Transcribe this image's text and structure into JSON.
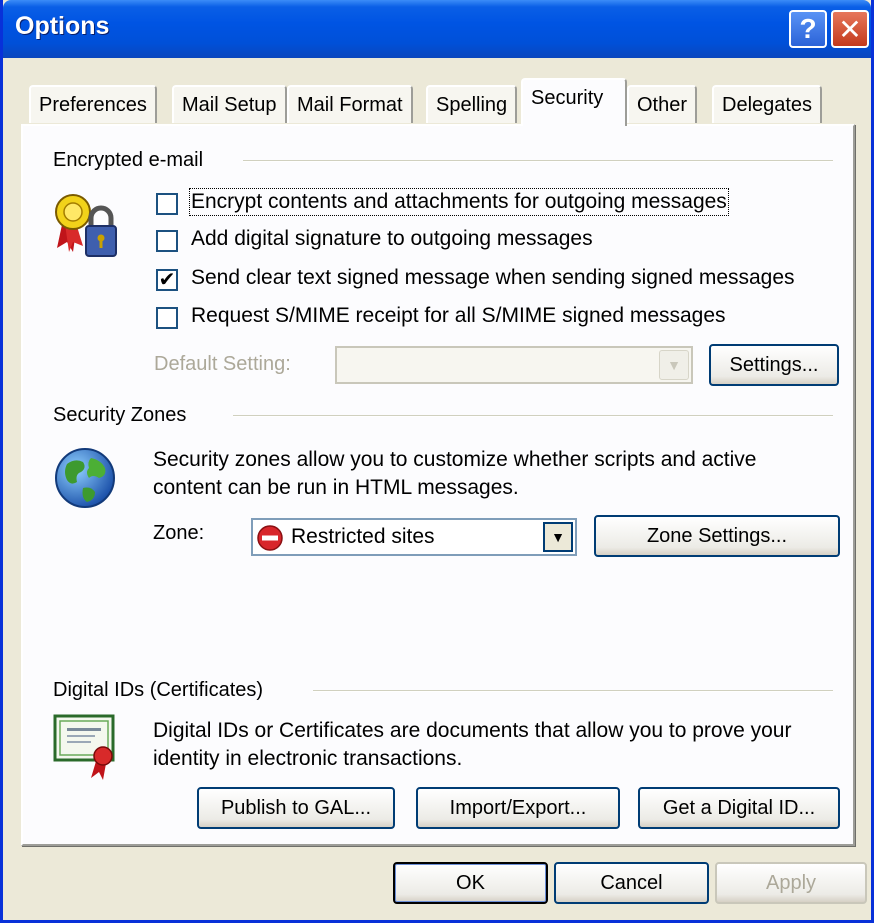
{
  "window": {
    "title": "Options"
  },
  "titlebar": {
    "help_glyph": "?",
    "close_glyph": "✕"
  },
  "tabs": [
    {
      "label": "Preferences"
    },
    {
      "label": "Mail Setup"
    },
    {
      "label": "Mail Format"
    },
    {
      "label": "Spelling"
    },
    {
      "label": "Security",
      "active": true
    },
    {
      "label": "Other"
    },
    {
      "label": "Delegates"
    }
  ],
  "encrypted": {
    "heading": "Encrypted e-mail",
    "icon": "certificate-lock-icon",
    "options": [
      {
        "label": "Encrypt contents and attachments for outgoing messages",
        "checked": false
      },
      {
        "label": "Add digital signature to outgoing messages",
        "checked": false
      },
      {
        "label": "Send clear text signed message when sending signed messages",
        "checked": true
      },
      {
        "label": "Request S/MIME receipt for all S/MIME signed messages",
        "checked": false
      }
    ],
    "default_setting_label": "Default Setting:",
    "default_setting_value": "",
    "settings_button": "Settings..."
  },
  "zones": {
    "heading": "Security Zones",
    "icon": "globe-icon",
    "description_line1": "Security zones allow you to customize whether scripts and active",
    "description_line2": "content can be run in HTML messages.",
    "zone_label": "Zone:",
    "zone_value": "Restricted sites",
    "zone_icon": "restricted-icon",
    "zone_settings_button": "Zone Settings..."
  },
  "digital_ids": {
    "heading": "Digital IDs (Certificates)",
    "icon": "certificate-icon",
    "description_line1": "Digital IDs or Certificates are documents that allow you to prove your",
    "description_line2": "identity in electronic transactions.",
    "publish_button": "Publish to GAL...",
    "import_export_button": "Import/Export...",
    "get_id_button": "Get a Digital ID..."
  },
  "footer": {
    "ok": "OK",
    "cancel": "Cancel",
    "apply": "Apply"
  },
  "colors": {
    "titlebar": "#0054e3",
    "dialog_bg": "#ece9d8",
    "panel_bg": "#fcfcfe",
    "disabled_text": "#aca899"
  }
}
